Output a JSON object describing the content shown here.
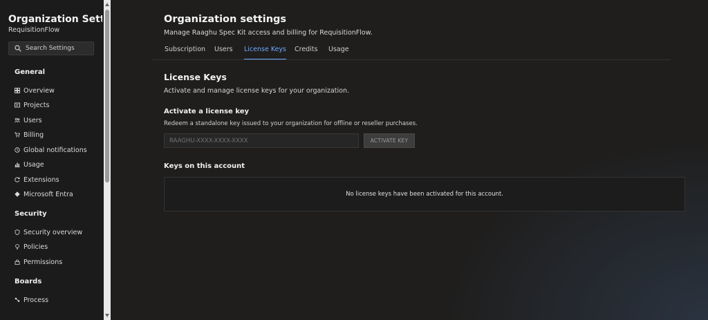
{
  "sidebar": {
    "title": "Organization Settin...",
    "subtitle": "RequisitionFlow",
    "search_placeholder": "Search Settings",
    "sections": [
      {
        "heading": "General",
        "items": [
          {
            "label": "Overview",
            "icon": "grid-icon"
          },
          {
            "label": "Projects",
            "icon": "projects-icon"
          },
          {
            "label": "Users",
            "icon": "users-icon"
          },
          {
            "label": "Billing",
            "icon": "cart-icon"
          },
          {
            "label": "Global notifications",
            "icon": "notification-icon"
          },
          {
            "label": "Usage",
            "icon": "chart-icon"
          },
          {
            "label": "Extensions",
            "icon": "extension-icon"
          },
          {
            "label": "Microsoft Entra",
            "icon": "entra-icon"
          }
        ]
      },
      {
        "heading": "Security",
        "items": [
          {
            "label": "Security overview",
            "icon": "shield-icon"
          },
          {
            "label": "Policies",
            "icon": "bulb-icon"
          },
          {
            "label": "Permissions",
            "icon": "lock-icon"
          }
        ]
      },
      {
        "heading": "Boards",
        "items": [
          {
            "label": "Process",
            "icon": "process-icon"
          }
        ]
      }
    ]
  },
  "header": {
    "title": "Organization settings",
    "subtitle": "Manage Raaghu Spec Kit access and billing for RequisitionFlow."
  },
  "tabs": [
    {
      "label": "Subscription",
      "active": false
    },
    {
      "label": "Users",
      "active": false
    },
    {
      "label": "License Keys",
      "active": true
    },
    {
      "label": "Credits",
      "active": false
    },
    {
      "label": "Usage",
      "active": false
    }
  ],
  "license": {
    "title": "License Keys",
    "description": "Activate and manage license keys for your organization.",
    "activate_heading": "Activate a license key",
    "activate_desc": "Redeem a standalone key issued to your organization for offline or reseller purchases.",
    "input_placeholder": "RAAGHU-XXXX-XXXX-XXXX",
    "input_value": "",
    "activate_button": "ACTIVATE KEY",
    "keys_heading": "Keys on this account",
    "empty_message": "No license keys have been activated for this account."
  },
  "colors": {
    "background": "#1f1e1d",
    "sidebar": "#1b1b1b",
    "accent": "#6ea8ff"
  }
}
